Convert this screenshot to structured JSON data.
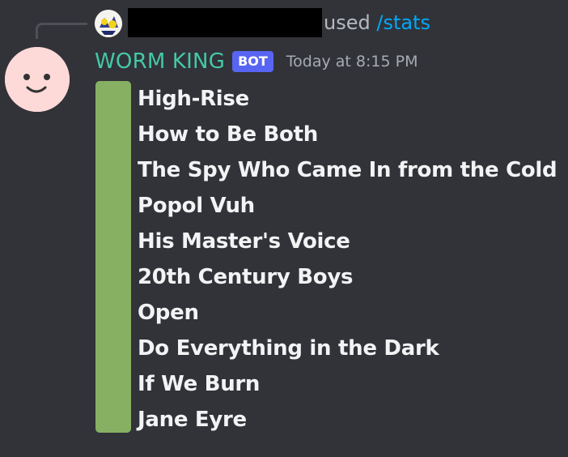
{
  "reply": {
    "used_text": "used",
    "command": "/stats"
  },
  "message": {
    "username": "WORM KING",
    "bot_tag": "BOT",
    "timestamp": "Today at 8:15 PM",
    "items": [
      {
        "title": "High-Rise"
      },
      {
        "title": "How to Be Both"
      },
      {
        "title": "The Spy Who Came In from the Cold"
      },
      {
        "title": "Popol Vuh"
      },
      {
        "title": "His Master's Voice"
      },
      {
        "title": "20th Century Boys"
      },
      {
        "title": "Open"
      },
      {
        "title": "Do Everything in the Dark"
      },
      {
        "title": "If We Burn"
      },
      {
        "title": "Jane Eyre"
      }
    ]
  },
  "colors": {
    "background": "#313338",
    "username": "#45c9a5",
    "bot_tag": "#5865f2",
    "command": "#00a8fc",
    "list_bar": "#87b062"
  },
  "icons": {
    "reply_avatar": "reply-user-avatar-icon",
    "bot_avatar": "smiley-face-avatar-icon"
  }
}
